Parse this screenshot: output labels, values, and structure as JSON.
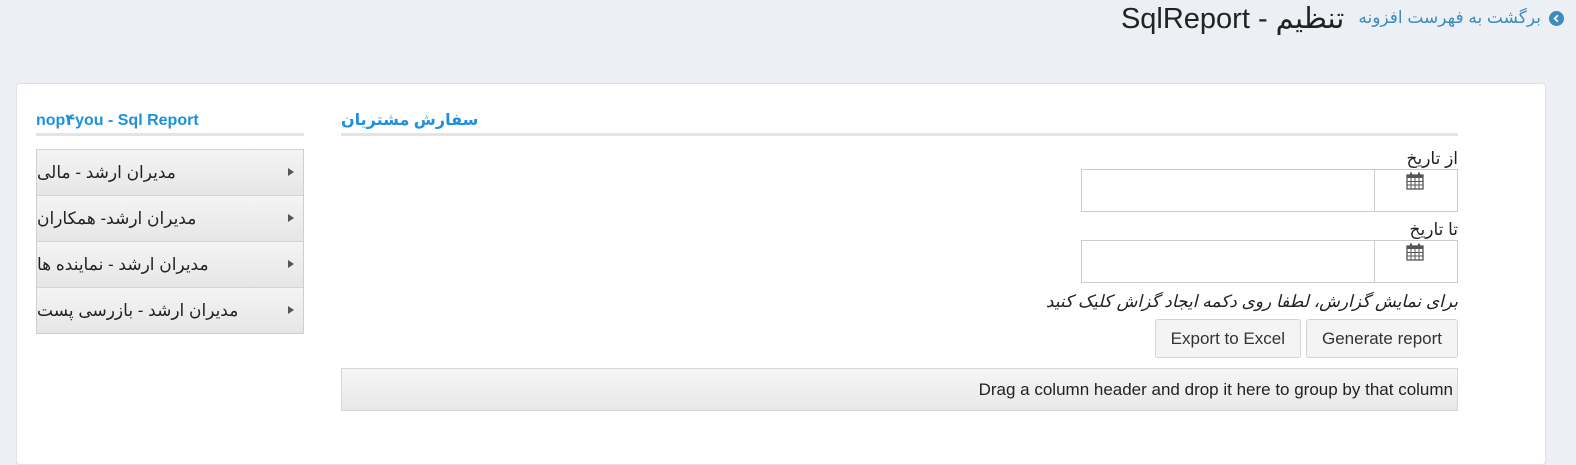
{
  "header": {
    "title": "تنظیم - SqlReport",
    "back_link": "برگشت به فهرست افزونه",
    "back_icon": "arrow-left-circle-icon"
  },
  "sidebar": {
    "title": "nop۴you - Sql Report",
    "items": [
      {
        "label": "مدیران ارشد - مالی"
      },
      {
        "label": "مدیران ارشد- همکاران"
      },
      {
        "label": "مدیران ارشد - نماینده ها"
      },
      {
        "label": "مدیران ارشد - بازرسی پست"
      }
    ]
  },
  "main": {
    "section_title": "سفارش مشتریان",
    "from_label": "از تاریخ",
    "from_value": "",
    "to_label": "تا تاریخ",
    "to_value": "",
    "hint": "برای نمایش گزارش، لطفا روی دکمه ایجاد گزاش کلیک کنید",
    "export_button": "Export to Excel",
    "generate_button": "Generate report",
    "group_hint": "Drag a column header and drop it here to group by that column"
  },
  "colors": {
    "accent": "#1e90e0",
    "link": "#3c8dbc",
    "background": "#ecf0f5"
  }
}
